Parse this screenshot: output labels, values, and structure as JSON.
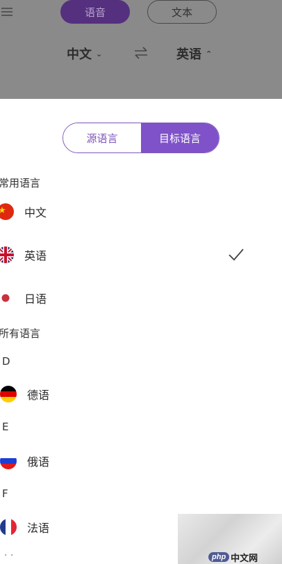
{
  "header": {
    "mode_tabs": [
      {
        "label": "语音",
        "active": true
      },
      {
        "label": "文本",
        "active": false
      }
    ],
    "source_lang": "中文",
    "target_lang": "英语",
    "source_chevron": "chevron-down-icon",
    "target_chevron": "chevron-up-icon",
    "swap_icon": "swap-arrows-icon"
  },
  "sheet": {
    "segment": {
      "source_label": "源语言",
      "target_label": "目标语言",
      "selected": "目标语言"
    },
    "common_title": "常用语言",
    "common_languages": [
      {
        "label": "中文",
        "flag": "china-flag-icon",
        "selected": false
      },
      {
        "label": "英语",
        "flag": "uk-flag-icon",
        "selected": true
      },
      {
        "label": "日语",
        "flag": "japan-flag-icon",
        "selected": false
      }
    ],
    "all_title": "所有语言",
    "groups": [
      {
        "letter": "D",
        "languages": [
          {
            "label": "德语",
            "flag": "germany-flag-icon"
          }
        ]
      },
      {
        "letter": "E",
        "languages": [
          {
            "label": "俄语",
            "flag": "russia-flag-icon"
          }
        ]
      },
      {
        "letter": "F",
        "languages": [
          {
            "label": "法语",
            "flag": "france-flag-icon"
          }
        ]
      }
    ]
  },
  "watermark": {
    "badge": "php",
    "site": "中文网"
  },
  "colors": {
    "accent": "#7f52c9",
    "overlay": "#8a8a8a",
    "voice_pill": "#55307e"
  }
}
